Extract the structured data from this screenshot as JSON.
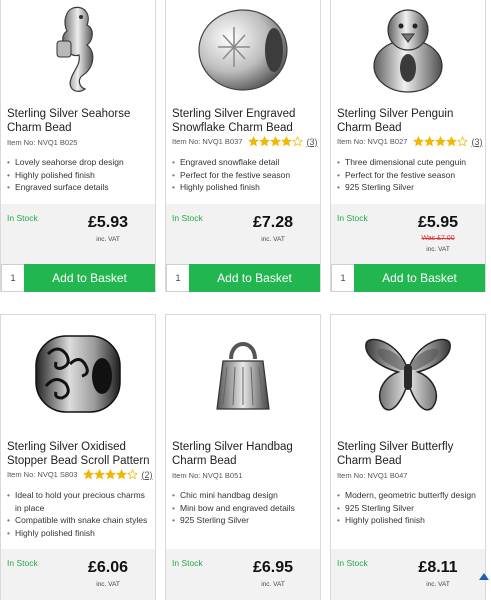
{
  "products": [
    {
      "title": "Sterling Silver Seahorse Charm Bead",
      "item_no": "Item No: NVQ1 B025",
      "rating": null,
      "review_count": "",
      "features": [
        "Lovely seahorse drop design",
        "Highly polished finish",
        "Engraved surface details"
      ],
      "stock": "In Stock",
      "price": "£5.93",
      "was": "",
      "vat": "inc. VAT",
      "qty": "1",
      "button": "Add to Basket",
      "icon": "seahorse-charm-image"
    },
    {
      "title": "Sterling Silver Engraved Snowflake Charm Bead",
      "item_no": "Item No: NVQ1 B037",
      "rating": 4,
      "review_count": "(3)",
      "features": [
        "Engraved snowflake detail",
        "Perfect for the festive season",
        "Highly polished finish"
      ],
      "stock": "In Stock",
      "price": "£7.28",
      "was": "",
      "vat": "inc. VAT",
      "qty": "1",
      "button": "Add to Basket",
      "icon": "snowflake-charm-image"
    },
    {
      "title": "Sterling Silver Penguin Charm Bead",
      "item_no": "Item No: NVQ1 B027",
      "rating": 4,
      "review_count": "(3)",
      "features": [
        "Three dimensional cute penguin",
        "Perfect for the festive season",
        "925 Sterling Silver"
      ],
      "stock": "In Stock",
      "price": "£5.95",
      "was": "Was £7.00",
      "vat": "inc. VAT",
      "qty": "1",
      "button": "Add to Basket",
      "icon": "penguin-charm-image"
    },
    {
      "title": "Sterling Silver Oxidised Stopper Bead Scroll Pattern",
      "item_no": "Item No: NVQ1 S803",
      "rating": 4,
      "review_count": "(2)",
      "features": [
        "Ideal to hold your precious charms in place",
        "Compatible with snake chain styles",
        "Highly polished finish"
      ],
      "stock": "In Stock",
      "price": "£6.06",
      "was": "",
      "vat": "inc. VAT",
      "icon": "stopper-bead-image"
    },
    {
      "title": "Sterling Silver Handbag Charm Bead",
      "item_no": "Item No: NVQ1 B051",
      "rating": null,
      "review_count": "",
      "features": [
        "Chic mini handbag design",
        "Mini bow and engraved details",
        "925 Sterling Silver"
      ],
      "stock": "In Stock",
      "price": "£6.95",
      "was": "",
      "vat": "inc. VAT",
      "icon": "handbag-charm-image"
    },
    {
      "title": "Sterling Silver Butterfly Charm Bead",
      "item_no": "Item No: NVQ1 B047",
      "rating": null,
      "review_count": "",
      "features": [
        "Modern, geometric butterfly design",
        "925 Sterling Silver",
        "Highly polished finish"
      ],
      "stock": "In Stock",
      "price": "£8.11",
      "was": "",
      "vat": "inc. VAT",
      "icon": "butterfly-charm-image"
    }
  ],
  "colors": {
    "accent": "#22b650",
    "stock": "#27a64c",
    "star": "#f2b705",
    "was": "#d33333",
    "scroll": "#1e5fb4"
  },
  "scroll_icon": "scroll-to-top-icon"
}
